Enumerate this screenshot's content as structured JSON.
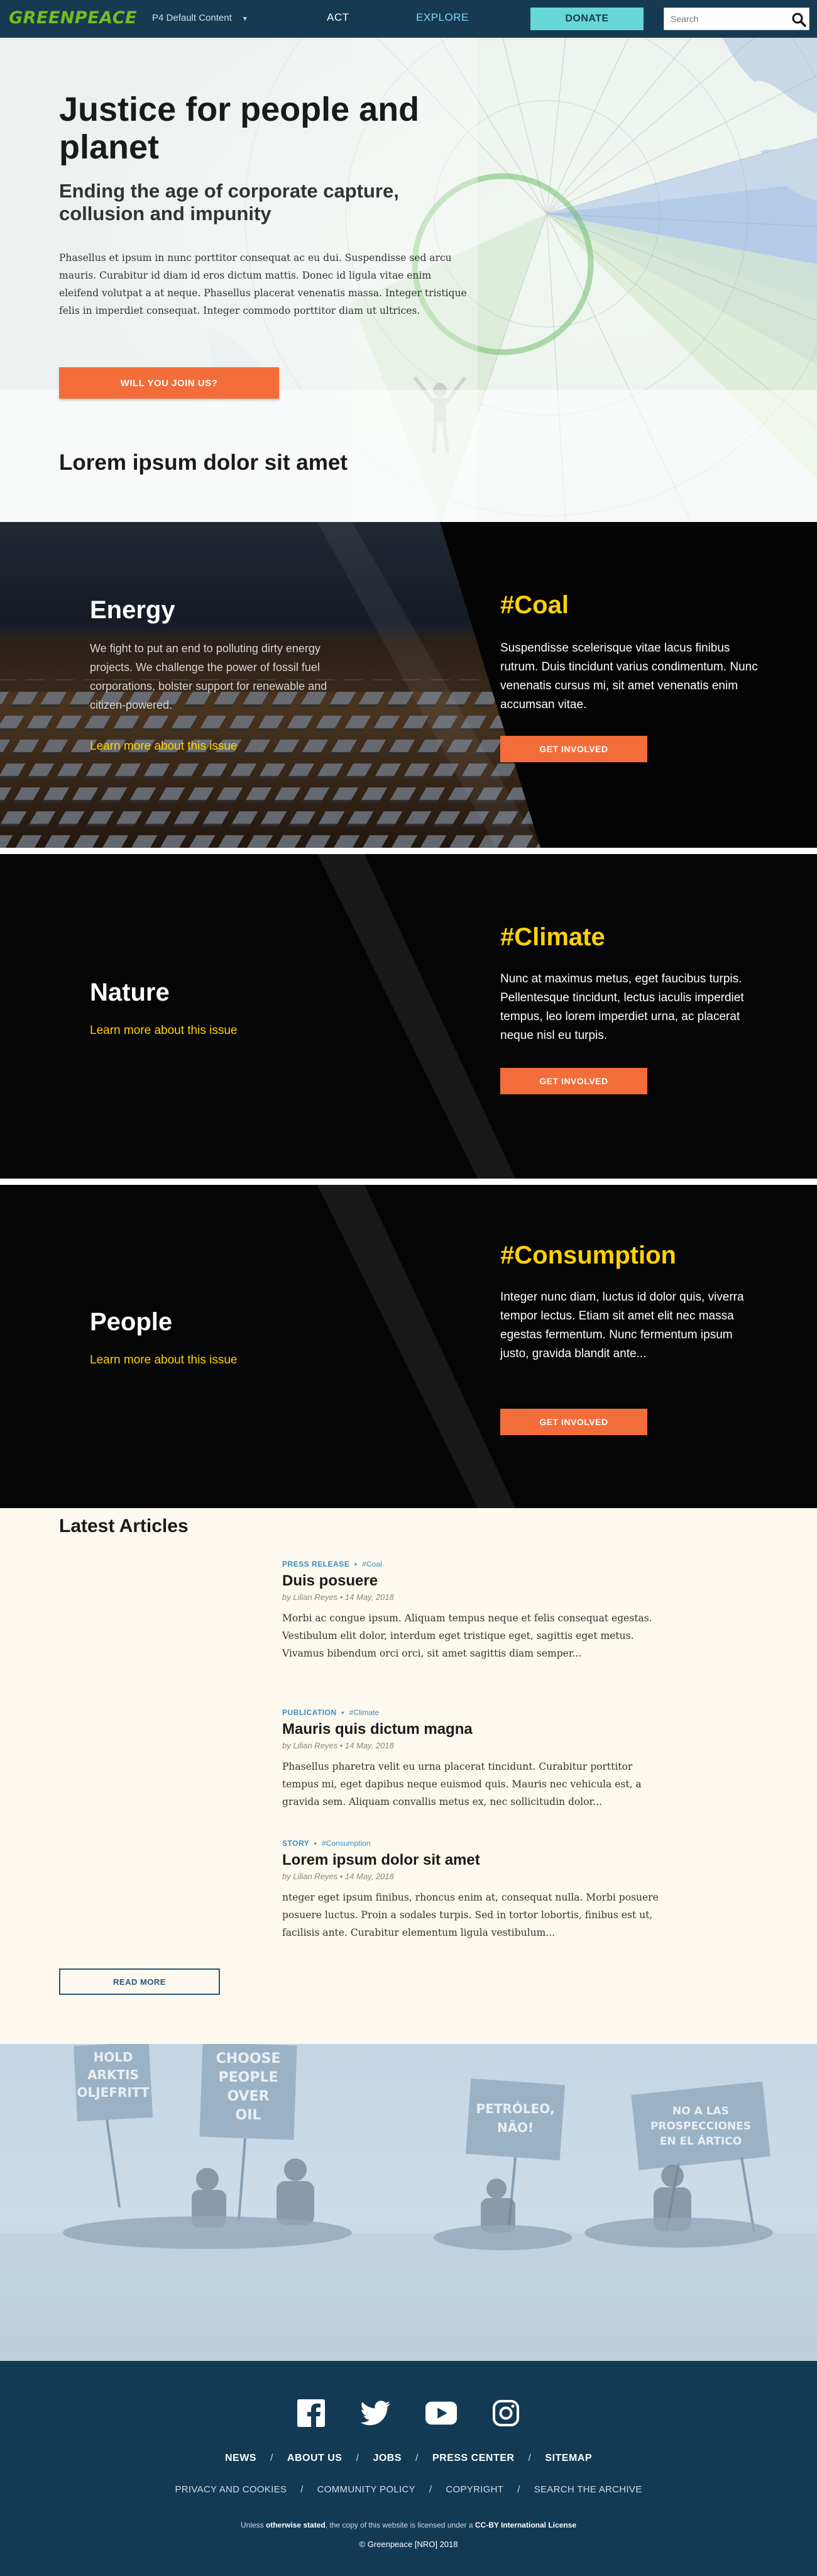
{
  "nav": {
    "logo": "GREENPEACE",
    "menu_label": "P4 Default Content",
    "menu_caret": "▼",
    "act": "ACT",
    "explore": "EXPLORE",
    "donate": "DONATE",
    "search_placeholder": "Search"
  },
  "hero": {
    "title": "Justice for people and planet",
    "subtitle": "Ending the age of corporate capture, collusion and impunity",
    "body": "Phasellus et ipsum in nunc porttitor consequat ac eu dui. Suspendisse sed arcu mauris. Curabitur id diam id eros dictum mattis. Donec id ligula vitae enim eleifend volutpat a at neque. Phasellus placerat venenatis massa. Integer tristique felis in imperdiet consequat. Integer commodo porttitor diam ut ultrices.",
    "button": "WILL YOU JOIN US?",
    "section_heading": "Lorem ipsum dolor sit amet"
  },
  "issues": [
    {
      "name": "Energy",
      "description": "We fight to put an end to polluting dirty energy projects. We challenge the power of fossil fuel corporations, bolster support for renewable and citizen-powered.",
      "link": "Learn more about this issue",
      "tag": "#Coal",
      "text": "Suspendisse scelerisque vitae lacus finibus rutrum. Duis tincidunt varius condimentum. Nunc venenatis cursus mi, sit amet venenatis enim accumsan vitae.",
      "button": "GET INVOLVED"
    },
    {
      "name": "Nature",
      "link": "Learn more about this issue",
      "tag": "#Climate",
      "text": "Nunc at maximus metus, eget faucibus turpis. Pellentesque tincidunt, lectus iaculis imperdiet tempus, leo lorem imperdiet urna, ac placerat neque nisl eu turpis.",
      "button": "GET INVOLVED"
    },
    {
      "name": "People",
      "link": "Learn more about this issue",
      "tag": "#Consumption",
      "text": "Integer nunc diam, luctus id dolor quis, viverra tempor lectus. Etiam sit amet elit nec massa egestas fermentum. Nunc fermentum ipsum justo, gravida blandit ante...",
      "button": "GET INVOLVED"
    }
  ],
  "articles": {
    "heading": "Latest Articles",
    "items": [
      {
        "type": "PRESS RELEASE",
        "tag": "#Coal",
        "title": "Duis posuere",
        "byline": "by Lilian Reyes • 14 May, 2018",
        "excerpt": "Morbi ac congue ipsum. Aliquam tempus neque et felis consequat egestas. Vestibulum elit dolor, interdum eget tristique eget, sagittis eget metus. Vivamus bibendum orci orci, sit amet sagittis diam semper..."
      },
      {
        "type": "PUBLICATION",
        "tag": "#Climate",
        "title": "Mauris quis dictum magna",
        "byline": "by Lilian Reyes • 14 May, 2018",
        "excerpt": "Phasellus pharetra velit eu urna placerat tincidunt. Curabitur porttitor tempus mi, eget dapibus neque euismod quis. Mauris nec vehicula est, a gravida sem. Aliquam convallis metus ex, nec sollicitudin dolor..."
      },
      {
        "type": "STORY",
        "tag": "#Consumption",
        "title": "Lorem ipsum dolor sit amet",
        "byline": "by Lilian Reyes • 14 May, 2018",
        "excerpt": "nteger eget ipsum finibus, rhoncus enim at, consequat nulla. Morbi posuere posuere luctus. Proin a sodales turpis. Sed in tortor lobortis, finibus est ut, facilisis ante. Curabitur elementum ligula vestibulum..."
      }
    ],
    "read_more": "READ MORE"
  },
  "photo": {
    "signs": [
      "HOLD ARKTIS OLJEFRITT",
      "CHOOSE PEOPLE OVER OIL",
      "PETRÓLEO, NÃO!",
      "NO A LAS PROSPECCIONES EN EL ÁRTICO"
    ]
  },
  "footer": {
    "social_icons": [
      "facebook-icon",
      "twitter-icon",
      "youtube-icon",
      "instagram-icon"
    ],
    "nav": [
      "NEWS",
      "ABOUT US",
      "JOBS",
      "PRESS CENTER",
      "SITEMAP"
    ],
    "links": [
      "PRIVACY AND COOKIES",
      "COMMUNITY POLICY",
      "COPYRIGHT",
      "SEARCH THE ARCHIVE"
    ],
    "separator": "/",
    "license_prefix": "Unless",
    "license_bold1": "otherwise stated",
    "license_middle": ", the copy of this website is licensed under a",
    "license_bold2": "CC-BY International License",
    "copyright": "© Greenpeace [NRO] 2018"
  },
  "colors": {
    "nav_bg": "#163a51",
    "logo_green": "#73be1e",
    "donate": "#66d6d9",
    "accent_orange": "#f36d3a",
    "issue_yellow": "#ffd204",
    "footer_bg": "#133a55",
    "article_meta_blue": "#3a8cc6"
  }
}
